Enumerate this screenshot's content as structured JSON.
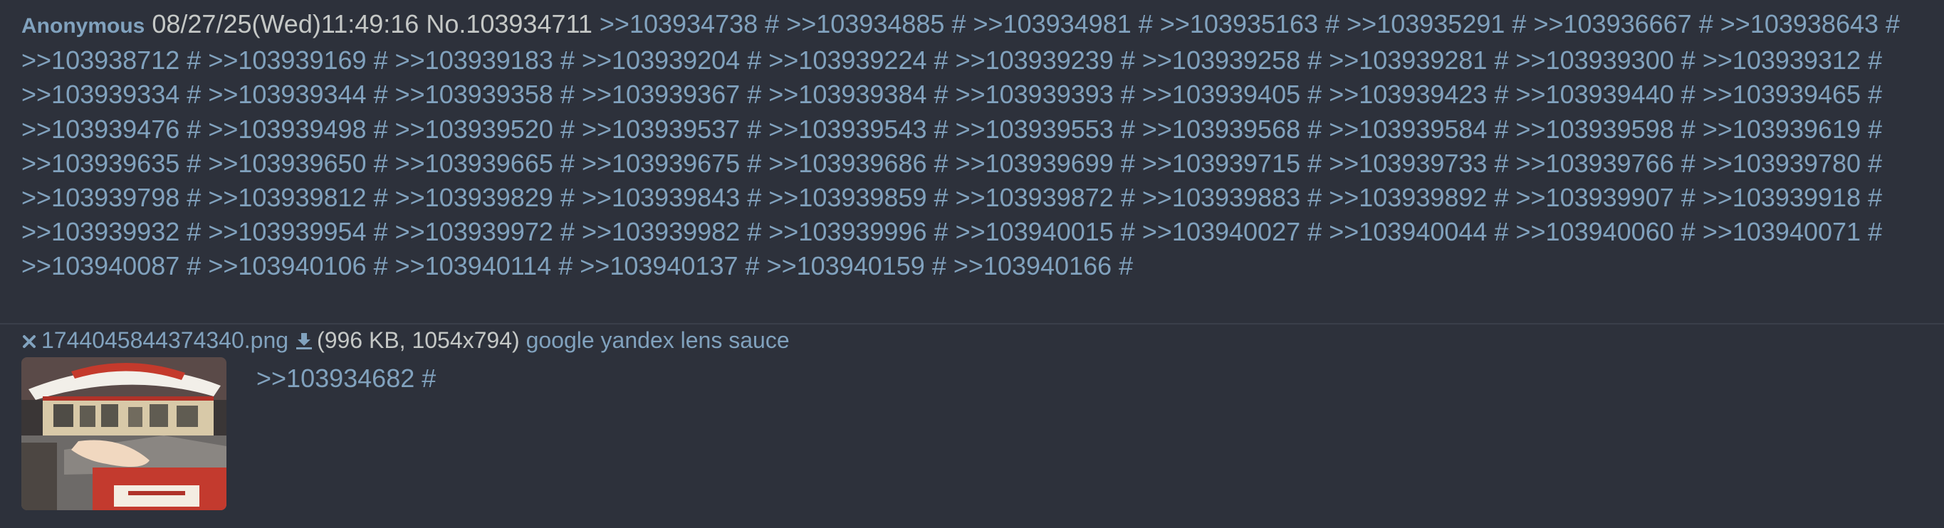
{
  "post": {
    "name": "Anonymous",
    "datetime": "08/27/25(Wed)11:49:16",
    "number": "No.103934711",
    "backlinks": [
      ">>103934738",
      ">>103934885",
      ">>103934981",
      ">>103935163",
      ">>103935291",
      ">>103936667",
      ">>103938643",
      ">>103938712",
      ">>103939169",
      ">>103939183",
      ">>103939204",
      ">>103939224",
      ">>103939239",
      ">>103939258",
      ">>103939281",
      ">>103939300",
      ">>103939312",
      ">>103939334",
      ">>103939344",
      ">>103939358",
      ">>103939367",
      ">>103939384",
      ">>103939393",
      ">>103939405",
      ">>103939423",
      ">>103939440",
      ">>103939465",
      ">>103939476",
      ">>103939498",
      ">>103939520",
      ">>103939537",
      ">>103939543",
      ">>103939553",
      ">>103939568",
      ">>103939584",
      ">>103939598",
      ">>103939619",
      ">>103939635",
      ">>103939650",
      ">>103939665",
      ">>103939675",
      ">>103939686",
      ">>103939699",
      ">>103939715",
      ">>103939733",
      ">>103939766",
      ">>103939780",
      ">>103939798",
      ">>103939812",
      ">>103939829",
      ">>103939843",
      ">>103939859",
      ">>103939872",
      ">>103939883",
      ">>103939892",
      ">>103939907",
      ">>103939918",
      ">>103939932",
      ">>103939954",
      ">>103939972",
      ">>103939982",
      ">>103939996",
      ">>103940015",
      ">>103940027",
      ">>103940044",
      ">>103940060",
      ">>103940071",
      ">>103940087",
      ">>103940106",
      ">>103940114",
      ">>103940137",
      ">>103940159",
      ">>103940166"
    ],
    "hash_symbol": "#"
  },
  "file": {
    "filename": "1744045844374340.png",
    "info": "(996 KB, 1054x794)",
    "search_links": [
      "google",
      "yandex",
      "lens",
      "sauce"
    ]
  },
  "body": {
    "quote": ">>103934682",
    "quote_hash": "#"
  },
  "colors": {
    "background": "#2d313b",
    "link": "#81a2be",
    "text": "#c5c8c6"
  },
  "icons": {
    "hide": "close-icon",
    "download": "download-icon"
  }
}
